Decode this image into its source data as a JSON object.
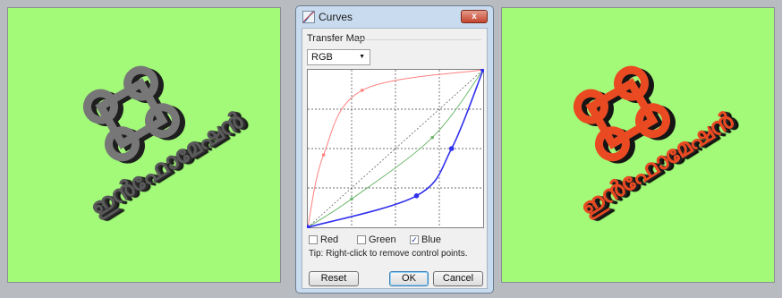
{
  "left_artwork": {
    "icon": "command-key-icon",
    "text": "ഇൻഫോമേഷൻ",
    "color": "#5a5a5a"
  },
  "right_artwork": {
    "icon": "command-key-icon",
    "text": "ഇൻഫോമേഷൻ",
    "color": "#ea4a22"
  },
  "panel_background": "#a2fa78",
  "dialog": {
    "title": "Curves",
    "title_icon": "curves-icon",
    "close_icon": "close-icon",
    "close_label": "x",
    "group_label": "Transfer Map",
    "channel": {
      "selected": "RGB"
    },
    "curves": {
      "red": [
        [
          0,
          0
        ],
        [
          0.09,
          0.46
        ],
        [
          0.31,
          0.87
        ],
        [
          1,
          1
        ]
      ],
      "green": [
        [
          0,
          0
        ],
        [
          0.25,
          0.18
        ],
        [
          0.71,
          0.57
        ],
        [
          1,
          1
        ]
      ],
      "blue": [
        [
          0,
          0
        ],
        [
          0.62,
          0.2
        ],
        [
          0.82,
          0.5
        ],
        [
          1,
          1
        ]
      ],
      "colors": {
        "red": "#ff8080",
        "green": "#6fb86f",
        "blue": "#3030ee"
      }
    },
    "checkboxes": [
      {
        "label": "Red",
        "checked": false
      },
      {
        "label": "Green",
        "checked": false
      },
      {
        "label": "Blue",
        "checked": true
      }
    ],
    "tip": "Tip: Right-click to remove control points.",
    "buttons": {
      "reset": "Reset",
      "ok": "OK",
      "cancel": "Cancel"
    }
  }
}
